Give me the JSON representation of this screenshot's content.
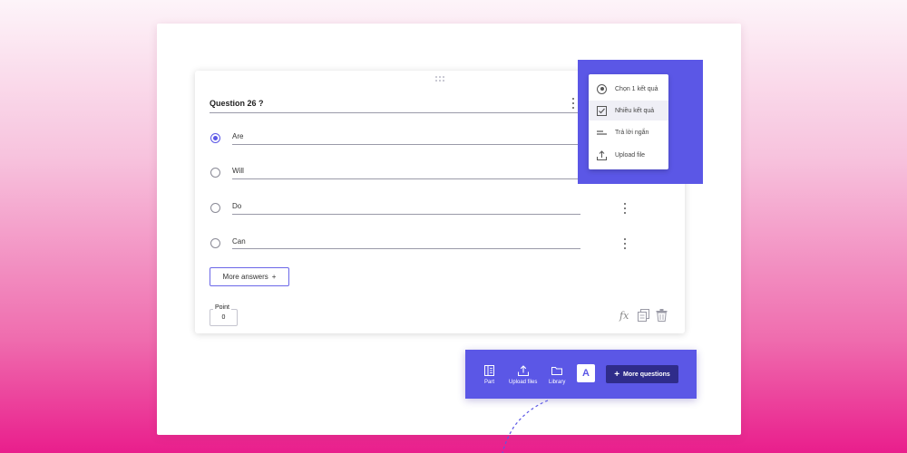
{
  "question": {
    "title": "Question 26 ?",
    "answers": [
      {
        "text": "Are",
        "checked": true
      },
      {
        "text": "Will",
        "checked": false
      },
      {
        "text": "Do",
        "checked": false
      },
      {
        "text": "Can",
        "checked": false
      }
    ],
    "more_answers_label": "More answers",
    "more_answers_icon": "+",
    "point_label": "Point",
    "point_value": "0",
    "fx_label": "fx"
  },
  "type_menu": {
    "items": [
      {
        "label": "Chọn 1 kết quả",
        "icon": "radio-icon"
      },
      {
        "label": "Nhiều kết quả",
        "icon": "checkbox-icon"
      },
      {
        "label": "Trả lời ngắn",
        "icon": "short-text-icon"
      },
      {
        "label": "Upload file",
        "icon": "upload-icon"
      }
    ]
  },
  "toolbar": {
    "part_label": "Part",
    "upload_label": "Upload files",
    "library_label": "Library",
    "ai_label": "A",
    "ai_spark": "✦",
    "more_questions_label": "More questions",
    "more_questions_icon": "+"
  },
  "colors": {
    "accent": "#5b57e6",
    "accent_dark": "#2f2c8a",
    "background_pink": "#e91e8c"
  }
}
